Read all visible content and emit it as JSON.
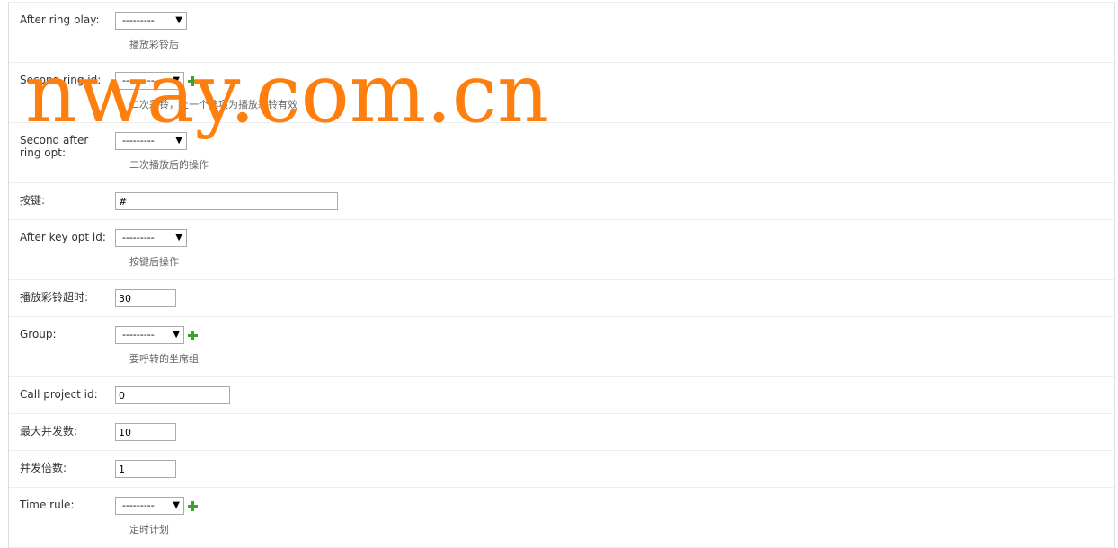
{
  "form": {
    "after_ring_play": {
      "label": "After ring play:",
      "value": "---------",
      "help": "播放彩铃后"
    },
    "second_ring_id": {
      "label": "Second ring id:",
      "value": "---------",
      "help": "二次彩铃，上一个选项为播放彩铃有效"
    },
    "second_after_ring_opt": {
      "label": "Second after ring opt:",
      "value": "---------",
      "help": "二次播放后的操作"
    },
    "key": {
      "label": "按键:",
      "value": "#"
    },
    "after_key_opt_id": {
      "label": "After key opt id:",
      "value": "---------",
      "help": "按键后操作"
    },
    "ring_timeout": {
      "label": "播放彩铃超时:",
      "value": "30"
    },
    "group": {
      "label": "Group:",
      "value": "---------",
      "help": "要呼转的坐席组"
    },
    "call_project_id": {
      "label": "Call project id:",
      "value": "0"
    },
    "max_concurrency": {
      "label": "最大并发数:",
      "value": "10"
    },
    "concurrency_multiplier": {
      "label": "并发倍数:",
      "value": "1"
    },
    "time_rule": {
      "label": "Time rule:",
      "value": "---------",
      "help": "定时计划"
    }
  },
  "watermark": {
    "text": "nway.com.cn",
    "color": "#ff7f0e"
  },
  "icons": {
    "dropdown_arrow": "▼",
    "add": "add-icon"
  },
  "colors": {
    "add_icon": "#3f9f2f",
    "border": "#dddddd",
    "help_text": "#666666"
  }
}
